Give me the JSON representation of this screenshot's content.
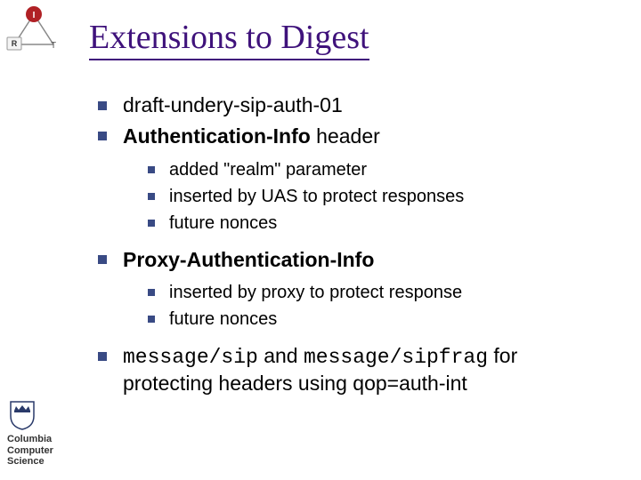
{
  "title": "Extensions to Digest",
  "corner": {
    "i": "I",
    "r": "R",
    "t": "T"
  },
  "bullets": {
    "b1": "draft-undery-sip-auth-01",
    "b2_bold": "Authentication-Info",
    "b2_rest": " header",
    "b2_sub": {
      "s1": "added \"realm\" parameter",
      "s2": "inserted by UAS to protect responses",
      "s3": "future nonces"
    },
    "b3_bold": "Proxy-Authentication-Info",
    "b3_sub": {
      "s1": "inserted by proxy to protect response",
      "s2": "future nonces"
    },
    "b4_mono1": "message/sip",
    "b4_mid": " and ",
    "b4_mono2": "message/sipfrag",
    "b4_rest": " for protecting headers using qop=auth-int"
  },
  "footer": {
    "line1": "Columbia",
    "line2": "Computer",
    "line3": "Science"
  }
}
